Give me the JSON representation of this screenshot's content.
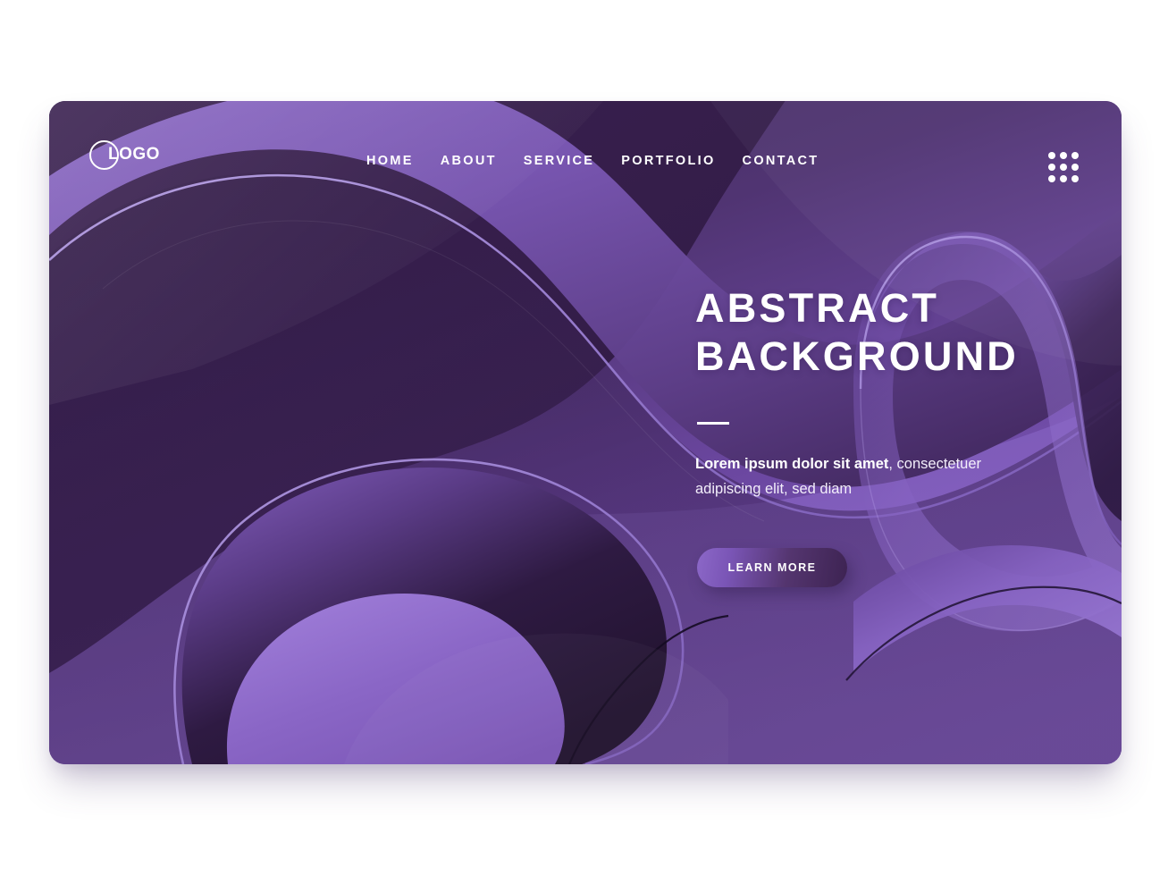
{
  "page": {
    "title": "Abstract Background Landing Page",
    "canvas_background": "#ffffff"
  },
  "card": {
    "corner_radius_px": 18,
    "base_color": "#4a3070"
  },
  "header": {
    "logo": {
      "text": "LOGO",
      "ring_icon": "circle-outline-icon"
    },
    "nav": {
      "items": [
        {
          "label": "HOME"
        },
        {
          "label": "ABOUT"
        },
        {
          "label": "SERVICE"
        },
        {
          "label": "PORTFOLIO"
        },
        {
          "label": "CONTACT"
        }
      ]
    },
    "menu_icon": {
      "name": "grid-dots-icon",
      "dot_count": 9,
      "color": "#ffffff"
    }
  },
  "hero": {
    "title_line_1": "ABSTRACT",
    "title_line_2": "BACKGROUND",
    "divider": true,
    "description_bold": "Lorem ipsum dolor sit amet",
    "description_rest": ", consectetuer adipiscing elit, sed diam",
    "cta_label": "LEARN MORE"
  },
  "colors": {
    "base_dark": "#3b2150",
    "base_deep": "#2f1a42",
    "mid_purple": "#5a3a82",
    "light_purple": "#7a56b0",
    "bright_purple": "#7e59bb",
    "pale_purple": "#8e6cc9",
    "stroke_lavender": "#9b7fd4",
    "text_white": "#ffffff",
    "body_text": "#f3eefb",
    "button_light": "#8c68c8",
    "button_dark": "#3d2352"
  }
}
